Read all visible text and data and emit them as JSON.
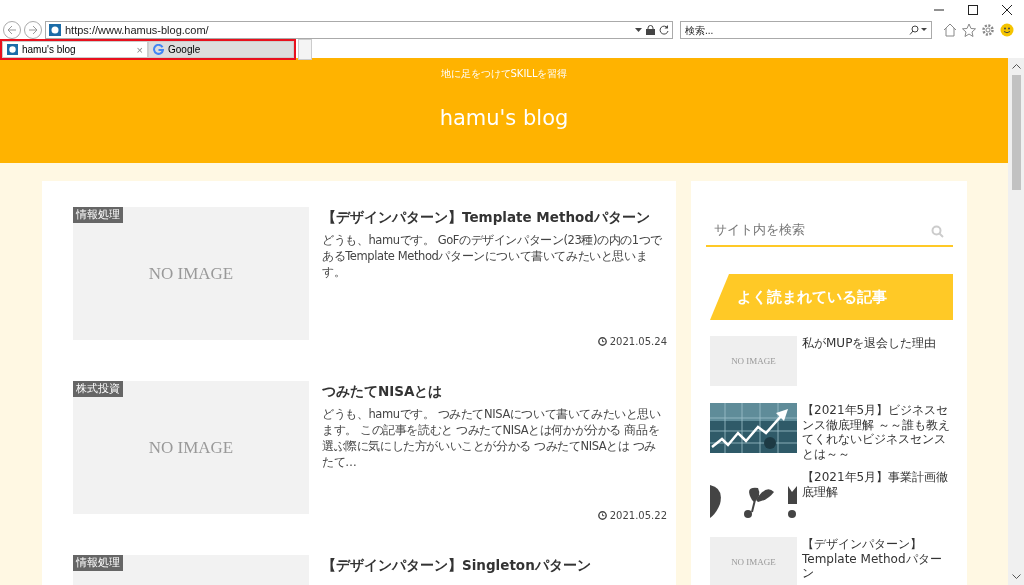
{
  "browser": {
    "address": "https://www.hamus-blog.com/",
    "search_placeholder": "検索...",
    "tabs": [
      {
        "title": "hamu's blog",
        "selected": true,
        "close_label": "×"
      },
      {
        "title": "Google",
        "selected": false
      }
    ]
  },
  "blog": {
    "tagline": "地に足をつけてSKILLを習得",
    "title": "hamu's blog"
  },
  "articles": [
    {
      "category": "情報処理",
      "thumb_text": "NO IMAGE",
      "title": "【デザインパターン】Template Methodパターン",
      "excerpt": "どうも、hamuです。 GoFのデザインパターン(23種)の内の1つであるTemplate Methodパターンについて書いてみたいと思います。",
      "date": "2021.05.24"
    },
    {
      "category": "株式投資",
      "thumb_text": "NO IMAGE",
      "title": "つみたてNISAとは",
      "excerpt": "どうも、hamuです。 つみたてNISAについて書いてみたいと思います。 この記事を読むと つみたてNISAとは何かが分かる 商品を選ぶ際に気にした方がいいことが分かる つみたてNISAとは つみたて…",
      "date": "2021.05.22"
    },
    {
      "category": "情報処理",
      "title": "【デザインパターン】Singletonパターン"
    }
  ],
  "sidebar": {
    "search_placeholder": "サイト内を検索",
    "heading": "よく読まれている記事",
    "items": [
      {
        "kind": "noimage",
        "thumb_text": "NO IMAGE",
        "title": "私がMUPを退会した理由"
      },
      {
        "kind": "picture",
        "title": "【2021年5月】ビジネスセンス徹底理解 ～～誰も教えてくれないビジネスセンスとは～～"
      },
      {
        "kind": "picture",
        "title": "【2021年5月】事業計画徹底理解"
      },
      {
        "kind": "noimage",
        "thumb_text": "NO IMAGE",
        "title": "【デザインパターン】Template Methodパターン"
      }
    ]
  }
}
